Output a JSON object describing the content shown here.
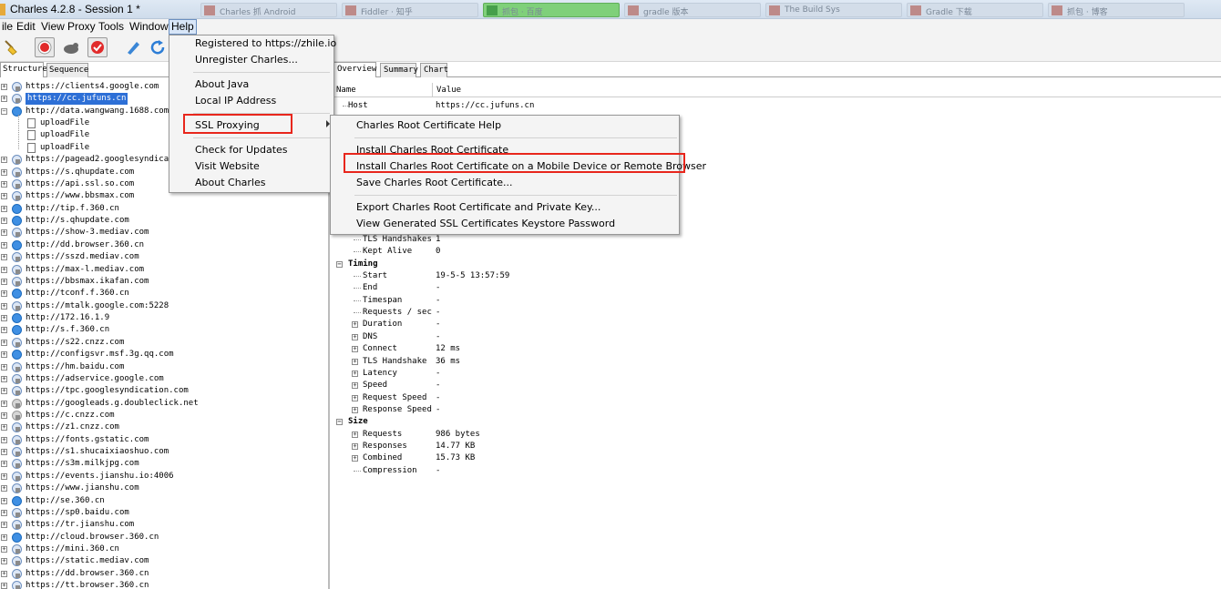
{
  "window": {
    "title": "Charles 4.2.8 - Session 1 *"
  },
  "background_tabs": [
    "Charles 抓 Android",
    "Fiddler · 知乎",
    "抓包 · 百度",
    "gradle 版本",
    "The Build Sys",
    "Gradle 下载",
    "抓包 · 博客"
  ],
  "menubar": [
    "ile",
    "Edit",
    "View",
    "Proxy",
    "Tools",
    "Window",
    "Help"
  ],
  "toolbar": {
    "icons": [
      "broom-icon",
      "record-icon",
      "throttle-icon",
      "breakpoint-icon",
      "pen-icon",
      "refresh-icon"
    ]
  },
  "left_tabs": [
    "Structure",
    "Sequence"
  ],
  "tree": [
    "https://clients4.google.com",
    "https://cc.jufuns.cn",
    "http://data.wangwang.1688.com",
    "uploadFile",
    "uploadFile",
    "uploadFile",
    "https://pagead2.googlesyndication.com",
    "https://s.qhupdate.com",
    "https://api.ssl.so.com",
    "https://www.bbsmax.com",
    "http://tip.f.360.cn",
    "http://s.qhupdate.com",
    "https://show-3.mediav.com",
    "http://dd.browser.360.cn",
    "https://sszd.mediav.com",
    "https://max-l.mediav.com",
    "https://bbsmax.ikafan.com",
    "http://tconf.f.360.cn",
    "https://mtalk.google.com:5228",
    "http://172.16.1.9",
    "http://s.f.360.cn",
    "https://s22.cnzz.com",
    "http://configsvr.msf.3g.qq.com",
    "https://hm.baidu.com",
    "https://adservice.google.com",
    "https://tpc.googlesyndication.com",
    "https://googleads.g.doubleclick.net",
    "https://c.cnzz.com",
    "https://z1.cnzz.com",
    "https://fonts.gstatic.com",
    "https://s1.shucaixiaoshuo.com",
    "https://s3m.milkjpg.com",
    "https://events.jianshu.io:4006",
    "https://www.jianshu.com",
    "http://se.360.cn",
    "https://sp0.baidu.com",
    "https://tr.jianshu.com",
    "http://cloud.browser.360.cn",
    "https://mini.360.cn",
    "https://static.mediav.com",
    "https://dd.browser.360.cn",
    "https://tt.browser.360.cn"
  ],
  "right_tabs": [
    "Overview",
    "Summary",
    "Chart"
  ],
  "overview": {
    "col_name": "Name",
    "col_value": "Value",
    "host_label": "Host",
    "host_value": "https://cc.jufuns.cn",
    "rows": [
      {
        "label": "TLS Handshakes",
        "value": "1"
      },
      {
        "label": "Kept Alive",
        "value": "0"
      },
      {
        "label": "Timing",
        "value": ""
      },
      {
        "label": "Start",
        "value": "19-5-5 13:57:59"
      },
      {
        "label": "End",
        "value": "-"
      },
      {
        "label": "Timespan",
        "value": "-"
      },
      {
        "label": "Requests / sec",
        "value": "-"
      },
      {
        "label": "Duration",
        "value": "-"
      },
      {
        "label": "DNS",
        "value": "-"
      },
      {
        "label": "Connect",
        "value": "12 ms"
      },
      {
        "label": "TLS Handshake",
        "value": "36 ms"
      },
      {
        "label": "Latency",
        "value": "-"
      },
      {
        "label": "Speed",
        "value": "-"
      },
      {
        "label": "Request Speed",
        "value": "-"
      },
      {
        "label": "Response Speed",
        "value": "-"
      },
      {
        "label": "Size",
        "value": ""
      },
      {
        "label": "Requests",
        "value": "986 bytes"
      },
      {
        "label": "Responses",
        "value": "14.77 KB"
      },
      {
        "label": "Combined",
        "value": "15.73 KB"
      },
      {
        "label": "Compression",
        "value": "-"
      }
    ]
  },
  "help_menu": {
    "items": [
      "Registered to https://zhile.io",
      "Unregister Charles...",
      "About Java",
      "Local IP Address",
      "SSL Proxying",
      "Check for Updates",
      "Visit Website",
      "About Charles"
    ]
  },
  "ssl_menu": {
    "items": [
      "Charles Root Certificate Help",
      "Install Charles Root Certificate",
      "Install Charles Root Certificate on a Mobile Device or Remote Browser",
      "Save Charles Root Certificate...",
      "Export Charles Root Certificate and Private Key...",
      "View Generated SSL Certificates Keystore Password"
    ]
  },
  "colors": {
    "highlight_box": "#e8261c",
    "selection": "#2d6fd6",
    "titlebar": "#dfe9f4"
  }
}
